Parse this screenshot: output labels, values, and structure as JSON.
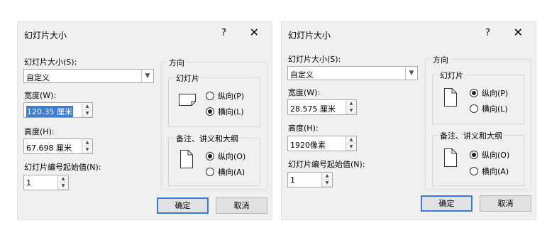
{
  "dialog1": {
    "title": "幻灯片大小",
    "help": "?",
    "close": "✕",
    "size_label": "幻灯片大小(S):",
    "size_value": "自定义",
    "width_label": "宽度(W):",
    "width_value": "120.35 厘米",
    "height_label": "高度(H):",
    "height_value": "67.698 厘米",
    "number_label": "幻灯片编号起始值(N):",
    "number_value": "1",
    "orientation_title": "方向",
    "slides_group": "幻灯片",
    "slides_portrait": "纵向(P)",
    "slides_landscape": "横向(L)",
    "slides_selected": "landscape",
    "notes_group": "备注、讲义和大纲",
    "notes_portrait": "纵向(O)",
    "notes_landscape": "横向(A)",
    "notes_selected": "portrait",
    "ok": "确定",
    "cancel": "取消"
  },
  "dialog2": {
    "title": "幻灯片大小",
    "help": "?",
    "close": "✕",
    "size_label": "幻灯片大小(S):",
    "size_value": "自定义",
    "width_label": "宽度(W):",
    "width_value": "28.575 厘米",
    "height_label": "高度(H):",
    "height_value": "1920像素",
    "number_label": "幻灯片编号起始值(N):",
    "number_value": "1",
    "orientation_title": "方向",
    "slides_group": "幻灯片",
    "slides_portrait": "纵向(P)",
    "slides_landscape": "横向(L)",
    "slides_selected": "portrait",
    "notes_group": "备注、讲义和大纲",
    "notes_portrait": "纵向(O)",
    "notes_landscape": "横向(A)",
    "notes_selected": "portrait",
    "ok": "确定",
    "cancel": "取消"
  }
}
